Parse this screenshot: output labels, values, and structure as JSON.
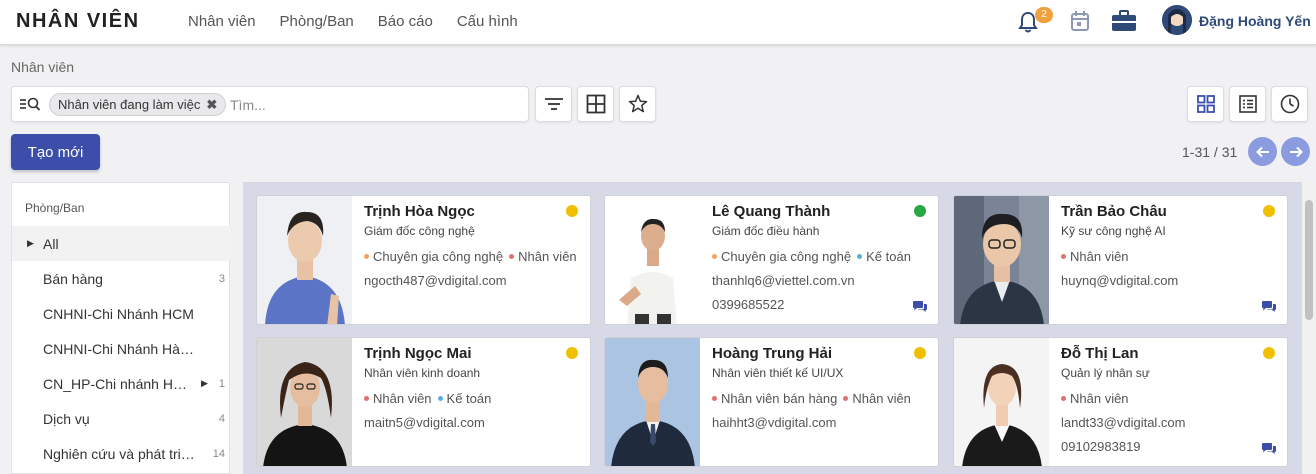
{
  "app": {
    "title": "NHÂN VIÊN"
  },
  "menu": [
    "Nhân viên",
    "Phòng/Ban",
    "Báo cáo",
    "Cấu hình"
  ],
  "systray": {
    "notification_count": "2",
    "user_name": "Đặng Hoàng Yến"
  },
  "breadcrumb": "Nhân viên",
  "search": {
    "facet": "Nhân viên đang làm việc",
    "placeholder": "Tìm..."
  },
  "actions": {
    "create": "Tạo mới"
  },
  "pager": {
    "value": "1-31 / 31"
  },
  "sidebar": {
    "title": "Phòng/Ban",
    "items": [
      {
        "label": "All",
        "count": ""
      },
      {
        "label": "Bán hàng",
        "count": "3"
      },
      {
        "label": "CNHNI-Chi Nhánh HCM",
        "count": ""
      },
      {
        "label": "CNHNI-Chi Nhánh Hà Nội",
        "count": ""
      },
      {
        "label": "CN_HP-Chi nhánh Hải Phòng",
        "count": "1"
      },
      {
        "label": "Dịch vụ",
        "count": "4"
      },
      {
        "label": "Nghiên cứu và phát triển",
        "count": "14"
      }
    ]
  },
  "colors": {
    "primary": "#3c4eaa",
    "status_yellow": "#f0c000",
    "status_green": "#28a745",
    "tag_orange": "#f4a261",
    "tag_red": "#e07070",
    "tag_blue": "#5aaee0"
  },
  "employees": [
    {
      "name": "Trịnh Hòa Ngọc",
      "job": "Giám đốc công nghệ",
      "tags": [
        "Chuyên gia công nghệ",
        "Nhân viên"
      ],
      "email": "ngocth487@vdigital.com",
      "phone": "",
      "status": "yellow"
    },
    {
      "name": "Lê Quang Thành",
      "job": "Giám đốc điều hành",
      "tags": [
        "Chuyên gia công nghệ",
        "Kế toán"
      ],
      "email": "thanhlq6@viettel.com.vn",
      "phone": "0399685522",
      "status": "green"
    },
    {
      "name": "Trần Bảo Châu",
      "job": "Kỹ sư công nghệ AI",
      "tags": [
        "Nhân viên"
      ],
      "email": "huynq@vdigital.com",
      "phone": "",
      "status": "yellow"
    },
    {
      "name": "Trịnh Ngọc Mai",
      "job": "Nhân viên kinh doanh",
      "tags": [
        "Nhân viên",
        "Kế toán"
      ],
      "email": "maitn5@vdigital.com",
      "phone": "",
      "status": "yellow"
    },
    {
      "name": "Hoàng Trung Hải",
      "job": "Nhân viên thiết kế UI/UX",
      "tags": [
        "Nhân viên bán hàng",
        "Nhân viên"
      ],
      "email": "haihht3@vdigital.com",
      "phone": "",
      "status": "yellow"
    },
    {
      "name": "Đỗ Thị Lan",
      "job": "Quản lý nhân sự",
      "tags": [
        "Nhân viên"
      ],
      "email": "landt33@vdigital.com",
      "phone": "09102983819",
      "status": "yellow"
    }
  ]
}
